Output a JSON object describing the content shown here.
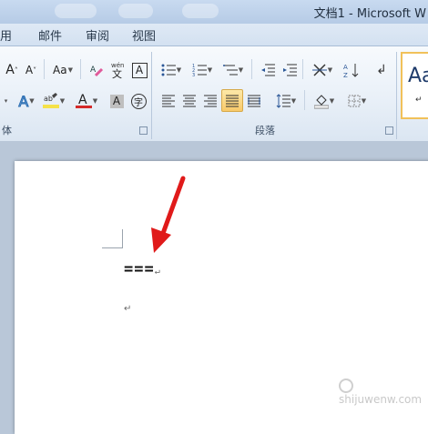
{
  "window": {
    "title": "文档1 - Microsoft W"
  },
  "tabs": [
    "用",
    "邮件",
    "审阅",
    "视图"
  ],
  "groups": {
    "font_label": "体",
    "paragraph_label": "段落"
  },
  "document": {
    "line1_text": "===",
    "paragraph_mark": "↵"
  },
  "styles": {
    "sample": "Aa",
    "mark": "↵"
  },
  "watermark": {
    "text": "shijuwenw.com"
  },
  "colors": {
    "highlight": "#f5e24a",
    "font_color": "#d42a2a",
    "arrow": "#e01a1a",
    "accent": "#f1c15a"
  },
  "icons": {
    "grow_font": "grow-font-icon",
    "shrink_font": "shrink-font-icon",
    "change_case": "change-case-icon",
    "phonetic": "phonetic-guide-icon",
    "char_border": "character-border-icon",
    "bullets": "bullets-icon",
    "numbering": "numbering-icon",
    "multilevel": "multilevel-list-icon",
    "decrease_indent": "decrease-indent-icon",
    "increase_indent": "increase-indent-icon",
    "sort": "sort-icon",
    "show_marks": "show-marks-icon"
  }
}
